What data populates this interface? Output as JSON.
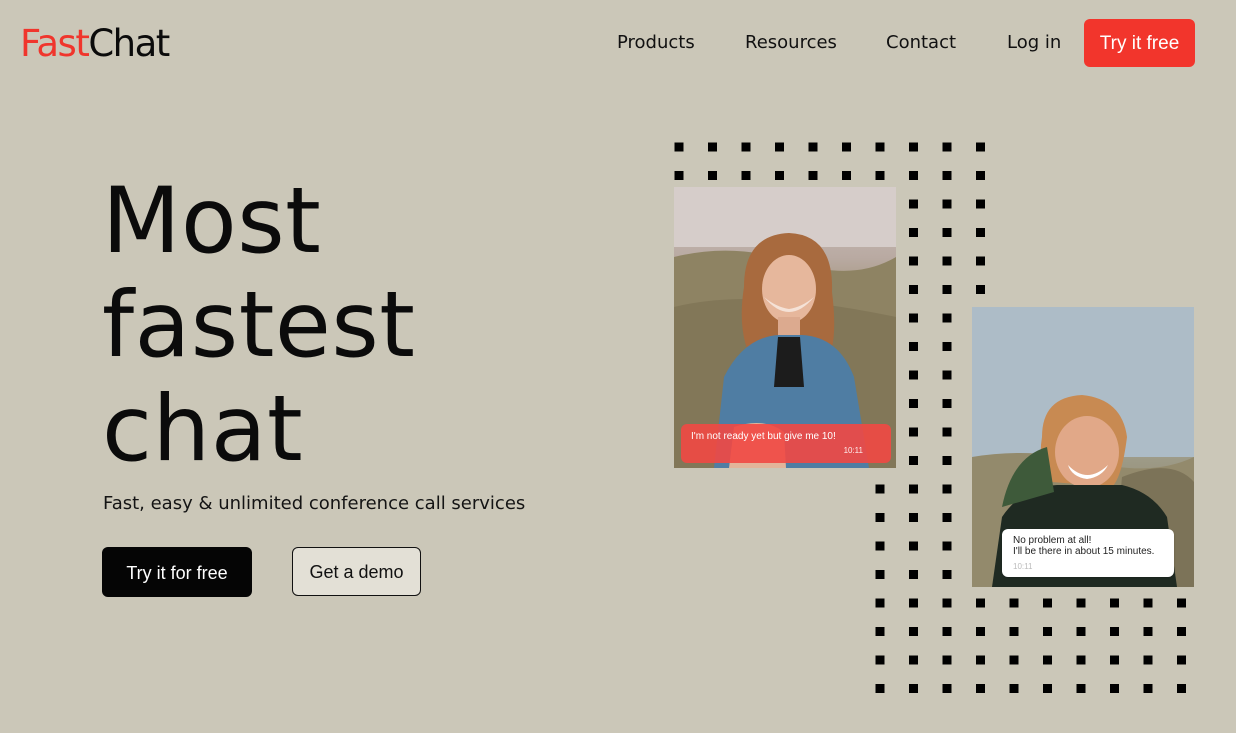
{
  "brand": {
    "part1": "Fast",
    "part2": "Chat",
    "accent_color": "#f2352c"
  },
  "nav": {
    "items": [
      {
        "label": "Products"
      },
      {
        "label": "Resources"
      },
      {
        "label": "Contact"
      },
      {
        "label": "Log in"
      }
    ],
    "cta": "Try it free"
  },
  "hero": {
    "headline": [
      "Most",
      "fastest",
      "chat"
    ],
    "subtitle": "Fast, easy & unlimited conference call services",
    "primary_button": "Try it for free",
    "secondary_button": "Get a demo"
  },
  "chat_cards": [
    {
      "image": "woman-in-denim-jacket-photo",
      "message": "I'm not ready yet but give me 10!",
      "time": "10:11",
      "bubble_color": "#f14844"
    },
    {
      "image": "man-with-backpack-photo",
      "message_lines": [
        "No problem at all!",
        "I'll be there in about 15 minutes."
      ],
      "time": "10:11",
      "bubble_color": "#ffffff"
    }
  ]
}
